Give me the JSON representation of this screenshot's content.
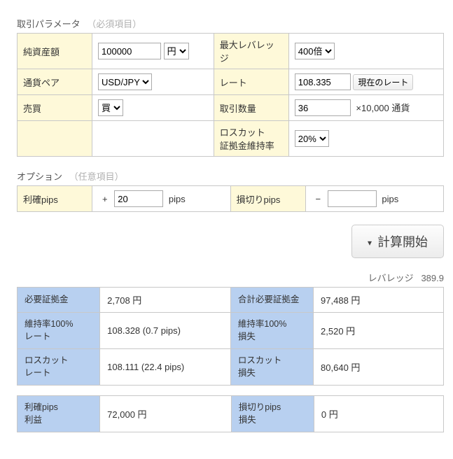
{
  "sections": {
    "params_title": "取引パラメータ",
    "params_note": "（必須項目）",
    "options_title": "オプション",
    "options_note": "（任意項目）"
  },
  "params": {
    "net_assets_label": "純資産額",
    "net_assets_value": "100000",
    "net_assets_unit": "円",
    "currency_pair_label": "通貨ペア",
    "currency_pair_value": "USD/JPY",
    "side_label": "売買",
    "side_value": "買",
    "leverage_label": "最大レバレッジ",
    "leverage_value": "400倍",
    "rate_label": "レート",
    "rate_value": "108.335",
    "rate_button": "現在のレート",
    "qty_label": "取引数量",
    "qty_value": "36",
    "qty_unit": "×10,000 通貨",
    "losscut_label_line1": "ロスカット",
    "losscut_label_line2": "証拠金維持率",
    "losscut_value": "20%"
  },
  "options": {
    "tp_label": "利確pips",
    "tp_sign": "+",
    "tp_value": "20",
    "tp_unit": "pips",
    "sl_label": "損切りpips",
    "sl_sign": "−",
    "sl_value": "",
    "sl_unit": "pips"
  },
  "calc_button": "計算開始",
  "leverage_display_label": "レバレッジ",
  "leverage_display_value": "389.9",
  "results1": {
    "r0l": "必要証拠金",
    "r0v": "2,708 円",
    "r1l": "合計必要証拠金",
    "r1v": "97,488 円",
    "r2l_line1": "維持率100%",
    "r2l_line2": "レート",
    "r2v": "108.328 (0.7 pips)",
    "r3l_line1": "維持率100%",
    "r3l_line2": "損失",
    "r3v": "2,520 円",
    "r4l_line1": "ロスカット",
    "r4l_line2": "レート",
    "r4v": "108.111 (22.4 pips)",
    "r5l_line1": "ロスカット",
    "r5l_line2": "損失",
    "r5v": "80,640 円"
  },
  "results2": {
    "r0l_line1": "利確pips",
    "r0l_line2": "利益",
    "r0v": "72,000 円",
    "r1l_line1": "損切りpips",
    "r1l_line2": "損失",
    "r1v": "0 円"
  }
}
